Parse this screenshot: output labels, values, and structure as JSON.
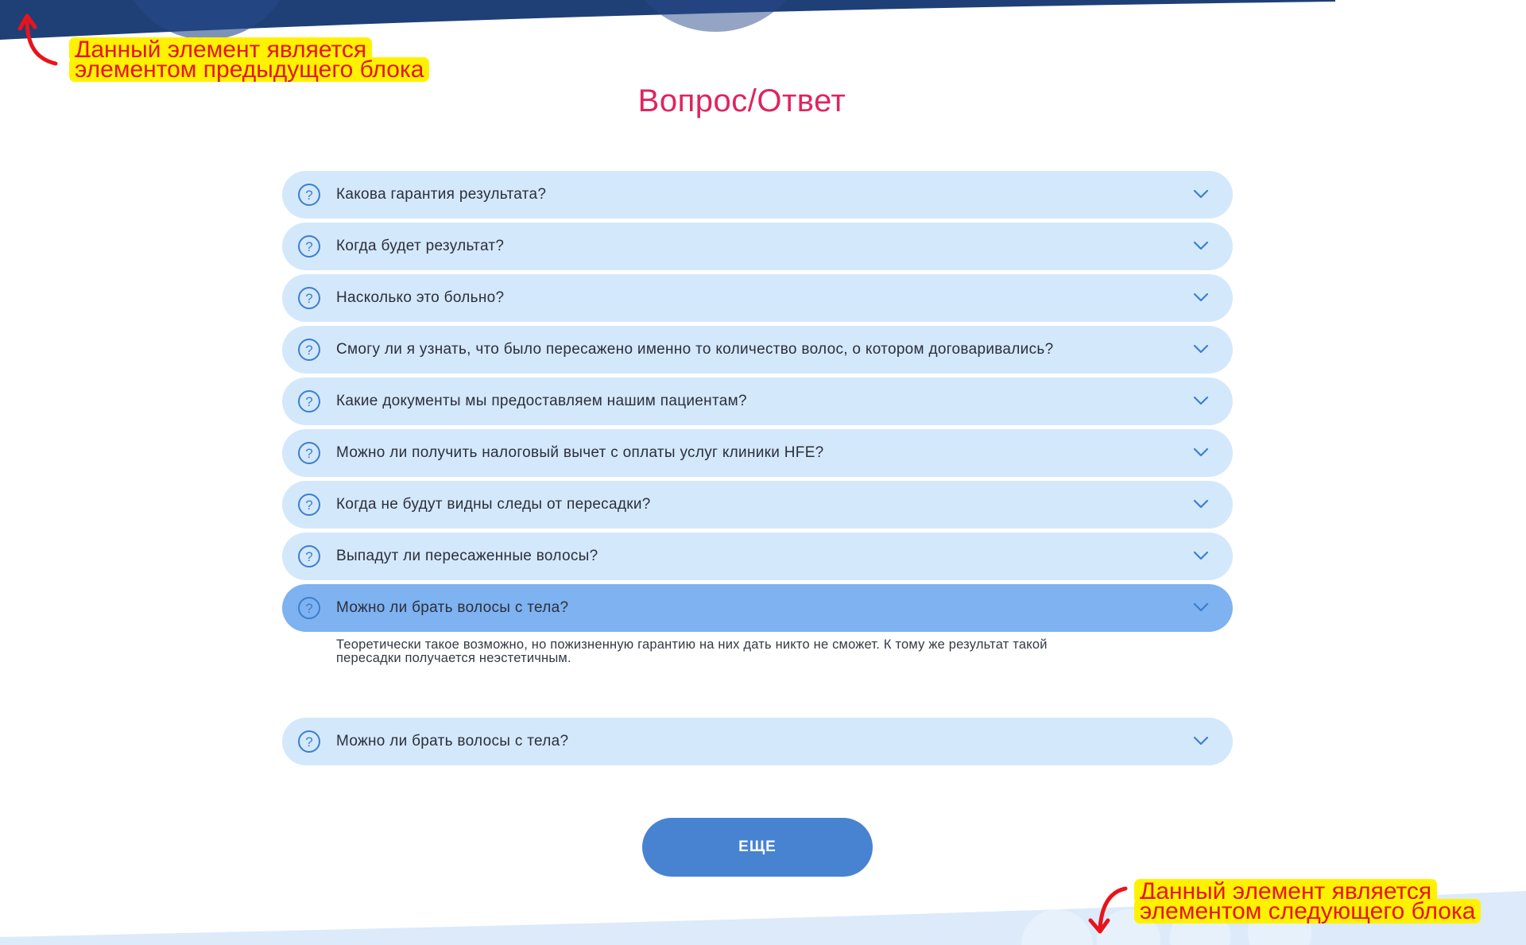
{
  "annotations": {
    "top_note": [
      "Данный элемент является",
      "элементом предыдущего блока"
    ],
    "bottom_note": [
      "Данный элемент является",
      "элементом следующего блока"
    ]
  },
  "section": {
    "title": "Вопрос/Ответ"
  },
  "faq": {
    "items": [
      {
        "question": "Какова гарантия результата?"
      },
      {
        "question": "Когда будет результат?"
      },
      {
        "question": "Насколько это больно?"
      },
      {
        "question": "Смогу ли я узнать, что было пересажено именно то количество волос, о котором договаривались?"
      },
      {
        "question": "Какие документы мы предоставляем нашим пациентам?"
      },
      {
        "question": "Можно ли получить налоговый вычет с оплаты услуг клиники HFE?"
      },
      {
        "question": "Когда не будут видны следы от пересадки?"
      },
      {
        "question": "Выпадут ли пересаженные волосы?"
      },
      {
        "question": "Можно ли брать волосы с тела?",
        "expanded": true,
        "answer": [
          "Теоретически такое возможно, но пожизненную гарантию на них дать никто не сможет. К тому же результат такой",
          "пересадки получается неэстетичным."
        ]
      },
      {
        "question": "Можно ли брать волосы с тела?"
      }
    ]
  },
  "more_button": {
    "label": "ЕЩЕ"
  },
  "colors": {
    "title": "#e0245e",
    "item_bg": "#d4e8fc",
    "item_open_bg": "#7eb2f0",
    "icon": "#3b7fd0",
    "button": "#4783d0",
    "header_band": "#1f3f77",
    "footer_band": "#dceafa",
    "note_bg": "#fff200",
    "note_text": "#e8141c"
  },
  "icons": {
    "question": "question-circle-icon",
    "chevron": "chevron-down-icon",
    "arrow": "curved-arrow-icon"
  }
}
